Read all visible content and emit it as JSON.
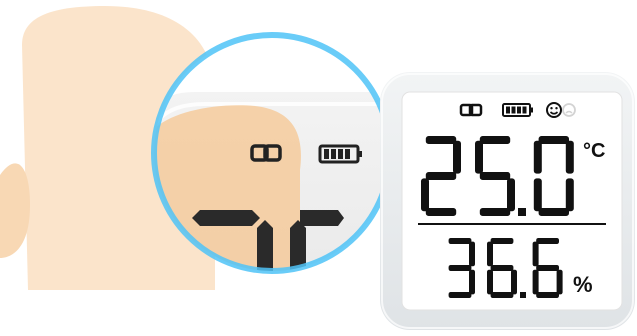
{
  "device": {
    "temperature": {
      "digits": [
        "2",
        "5",
        "0"
      ],
      "decimal_after_index": 1,
      "unit": "°C"
    },
    "humidity": {
      "digits": [
        "3",
        "6",
        "6"
      ],
      "decimal_after_index": 1,
      "unit": "%"
    },
    "status_icons": [
      "link-icon",
      "battery-icon",
      "smiley-comfort-icon",
      "comfort-indicator-faded-icon"
    ],
    "battery_level": 1.0
  },
  "magnifier": {
    "status_icons": [
      "link-icon",
      "battery-icon"
    ],
    "partial_digits": [
      "2",
      "5"
    ]
  },
  "colors": {
    "ring": "#4fc3f7",
    "hand_shadow": "#f5c89b",
    "lcd_segment": "#111111",
    "device_frame": "#e6e9eb",
    "device_screen": "#ffffff"
  }
}
